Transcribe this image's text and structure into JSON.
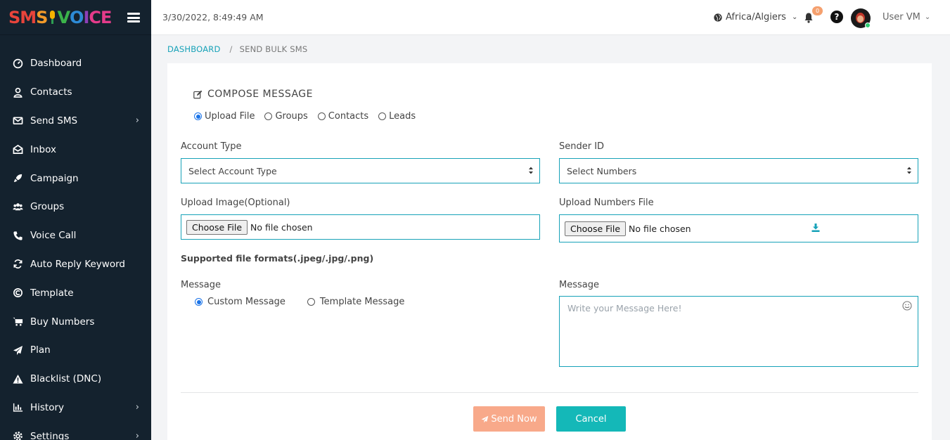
{
  "app": {
    "logo_text": "SMSVOICE"
  },
  "sidebar": {
    "items": [
      {
        "label": "Dashboard",
        "icon": "dashboard-icon",
        "has_submenu": false
      },
      {
        "label": "Contacts",
        "icon": "user-icon",
        "has_submenu": false
      },
      {
        "label": "Send SMS",
        "icon": "envelope-icon",
        "has_submenu": true
      },
      {
        "label": "Inbox",
        "icon": "inbox-icon",
        "has_submenu": false
      },
      {
        "label": "Campaign",
        "icon": "rocket-icon",
        "has_submenu": false
      },
      {
        "label": "Groups",
        "icon": "users-icon",
        "has_submenu": false
      },
      {
        "label": "Voice Call",
        "icon": "phone-icon",
        "has_submenu": false
      },
      {
        "label": "Auto Reply Keyword",
        "icon": "sync-icon",
        "has_submenu": false
      },
      {
        "label": "Template",
        "icon": "template-icon",
        "has_submenu": false
      },
      {
        "label": "Buy Numbers",
        "icon": "cart-icon",
        "has_submenu": false
      },
      {
        "label": "Plan",
        "icon": "paper-plane-icon",
        "has_submenu": false
      },
      {
        "label": "Blacklist (DNC)",
        "icon": "warning-icon",
        "has_submenu": false
      },
      {
        "label": "History",
        "icon": "bar-chart-icon",
        "has_submenu": true
      },
      {
        "label": "Settings",
        "icon": "gear-icon",
        "has_submenu": true
      }
    ]
  },
  "header": {
    "datetime": "3/30/2022, 8:49:49 AM",
    "timezone": "Africa/Algiers",
    "notification_count": "0",
    "help_glyph": "?",
    "user_name": "User VM"
  },
  "breadcrumb": {
    "home": "DASHBOARD",
    "separator": "/",
    "current": "SEND BULK SMS"
  },
  "compose": {
    "title": "COMPOSE MESSAGE",
    "source_options": [
      "Upload File",
      "Groups",
      "Contacts",
      "Leads"
    ],
    "source_selected": "Upload File",
    "account_type_label": "Account Type",
    "account_type_value": "Select Account Type",
    "sender_id_label": "Sender ID",
    "sender_id_value": "Select Numbers",
    "upload_image_label": "Upload Image(Optional)",
    "upload_numbers_label": "Upload Numbers File",
    "choose_file_label": "Choose File",
    "no_file_text": "No file chosen",
    "supported_formats": "Supported file formats(.jpeg/.jpg/.png)",
    "message_type_label": "Message",
    "message_type_options": [
      "Custom Message",
      "Template Message"
    ],
    "message_type_selected": "Custom Message",
    "message_label": "Message",
    "message_placeholder": "Write your Message Here!",
    "send_label": "Send Now",
    "cancel_label": "Cancel"
  },
  "colors": {
    "sidebar_bg": "#14222e",
    "accent_teal": "#17a2b8",
    "send_button": "#f8a98a",
    "cancel_button": "#14b8b8",
    "badge": "#f5a06e"
  }
}
